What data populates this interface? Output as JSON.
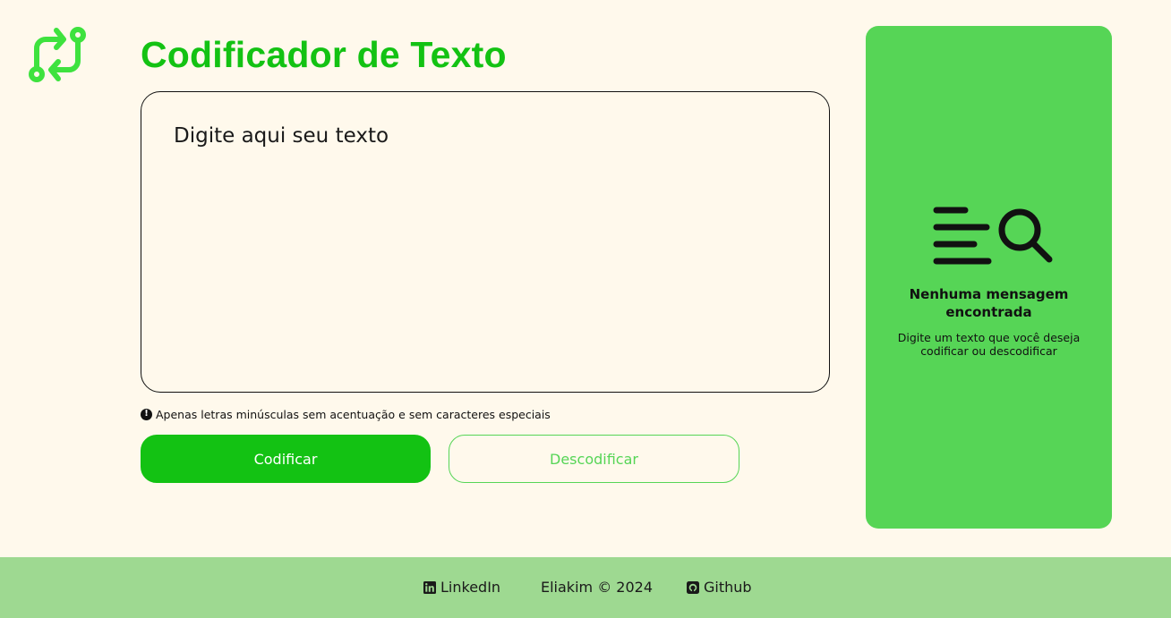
{
  "header": {
    "title": "Codificador de Texto",
    "logo_icon": "sync-arrows-icon"
  },
  "editor": {
    "placeholder": "Digite aqui seu texto",
    "value": ""
  },
  "notice": {
    "icon": "exclamation-circle-icon",
    "text": "Apenas letras minúsculas sem acentuação e sem caracteres especiais"
  },
  "actions": {
    "encode_label": "Codificar",
    "decode_label": "Descodificar"
  },
  "output_panel": {
    "icon": "search-list-icon",
    "title": "Nenhuma mensagem encontrada",
    "text": "Digite um texto que você deseja codificar ou descodificar"
  },
  "footer": {
    "linkedin_label": "LinkedIn",
    "copyright": "Eliakim © 2024",
    "github_label": "Github"
  },
  "colors": {
    "background": "#fff9ec",
    "brand_green": "#13c213",
    "panel_green": "#56d556",
    "footer_green": "#9ed991"
  }
}
